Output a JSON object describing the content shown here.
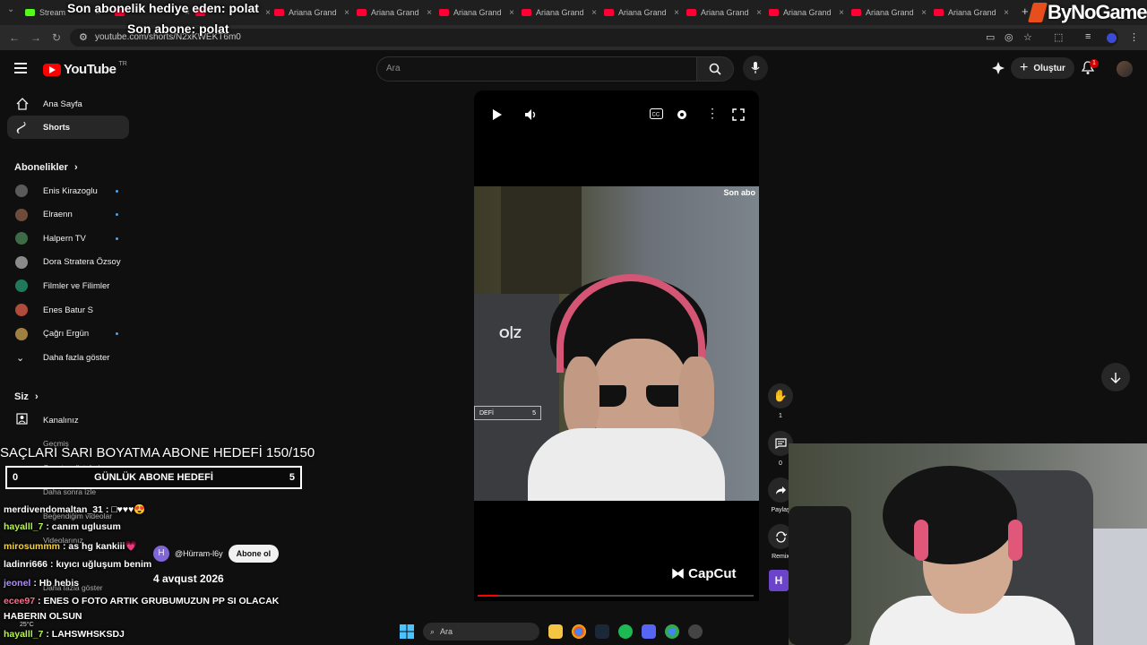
{
  "browser": {
    "tabs": [
      {
        "label": "Stream",
        "fav": "kick"
      },
      {
        "label": "",
        "fav": "youtube"
      },
      {
        "label": "",
        "fav": "youtube"
      },
      {
        "label": "Ariana Grand",
        "fav": "youtube"
      },
      {
        "label": "Ariana Grand",
        "fav": "youtube"
      },
      {
        "label": "Ariana Grand",
        "fav": "youtube"
      },
      {
        "label": "Ariana Grand",
        "fav": "youtube"
      },
      {
        "label": "Ariana Grand",
        "fav": "youtube"
      },
      {
        "label": "Ariana Grand",
        "fav": "youtube"
      },
      {
        "label": "Ariana Grand",
        "fav": "youtube"
      },
      {
        "label": "Ariana Grand",
        "fav": "youtube"
      },
      {
        "label": "Ariana Grand",
        "fav": "youtube"
      }
    ],
    "url": "youtube.com/shorts/N2xKWEKT6m0"
  },
  "youtube": {
    "logo_text": "YouTube",
    "logo_country": "TR",
    "search_placeholder": "Ara",
    "create_label": "Oluştur",
    "notification_count": "1"
  },
  "sidebar": {
    "main": [
      {
        "label": "Ana Sayfa",
        "icon": "home-icon"
      },
      {
        "label": "Shorts",
        "icon": "shorts-icon",
        "active": true
      }
    ],
    "subscriptions_title": "Abonelikler",
    "subscriptions": [
      {
        "label": "Enis Kirazoglu",
        "color": "#5a5a5a",
        "new": true
      },
      {
        "label": "Elraenn",
        "color": "#6e4b3a",
        "new": true
      },
      {
        "label": "Halpern TV",
        "color": "#3d6b45",
        "new": true
      },
      {
        "label": "Dora Stratera Özsoy",
        "color": "#8a8a8a",
        "new": false
      },
      {
        "label": "Filmler ve Filimler",
        "color": "#1f7a5a",
        "new": false
      },
      {
        "label": "Enes Batur S",
        "color": "#b04a3a",
        "new": false
      },
      {
        "label": "Çağrı Ergün",
        "color": "#a08040",
        "new": true
      }
    ],
    "show_more": "Daha fazla göster",
    "you_title": "Siz",
    "you_items": [
      {
        "label": "Kanalınız",
        "icon": "channel-icon"
      },
      {
        "label": "Geçmiş",
        "icon": "history-icon"
      },
      {
        "label": "Oynatma listeleri",
        "icon": "playlist-icon"
      },
      {
        "label": "Daha sonra izle",
        "icon": "watch-later-icon"
      },
      {
        "label": "Beğendiğim videolar",
        "icon": "like-icon"
      },
      {
        "label": "Videolarınız",
        "icon": "videos-icon"
      },
      {
        "label": "Daha fazla göster",
        "icon": "chevron-down-icon"
      }
    ]
  },
  "player": {
    "overlay_top_text": "Son abo",
    "overlay_goal_text": "DEFİ",
    "overlay_goal_value": "5",
    "watermark": "CapCut",
    "progress": 0.07
  },
  "actions": {
    "like_count": "1",
    "comment_count": "0",
    "share_label": "Paylaş",
    "remix_label": "Remix",
    "channel_initial": "H"
  },
  "stream": {
    "alert_line1": "Son abonelik hediye eden: polat",
    "alert_line2": "Son abone: polat",
    "brand": "ByNoGame",
    "goal_title": "SAÇLARI SARI BOYATMA ABONE HEDEFİ 150/150",
    "daily_goal": {
      "left": "0",
      "label": "GÜNLÜK ABONE HEDEFİ",
      "right": "5"
    },
    "chat": [
      {
        "user": "merdivendomaltan_31",
        "user_color": "#ffffff",
        "text": ": □♥♥♥😍"
      },
      {
        "user": "hayalll_7",
        "user_color": "#b8f25a",
        "text": ": canım uglusum"
      },
      {
        "user": "mirosummm",
        "user_color": "#f5d442",
        "text": ": as hg kankiii💗"
      },
      {
        "user": "ladinri666",
        "user_color": "#ffffff",
        "text": ": kıyıcı uğluşum benim"
      },
      {
        "user": "jeonel",
        "user_color": "#b28cff",
        "text": ": Hb hebis"
      },
      {
        "user": "ecee97",
        "user_color": "#ff6b8a",
        "text": ": ENES O FOTO ARTIK GRUBUMUZUN PP SI OLACAK"
      },
      {
        "user": "",
        "user_color": "#ffffff",
        "text": "HABERIN OLSUN"
      },
      {
        "user": "hayalll_7",
        "user_color": "#b8f25a",
        "text": ": LAHSWHSKSDJ"
      }
    ],
    "shorts_channel": "@Hürram-l6y",
    "subscribe_label": "Abone ol",
    "date": "4 avqust 2026",
    "weather": "25°C"
  },
  "taskbar": {
    "search_label": "Ara"
  },
  "colors": {
    "background": "#0f0f0f",
    "accent_red": "#ff0000",
    "chip": "#272727",
    "brand_orange": "#e84e1b"
  }
}
